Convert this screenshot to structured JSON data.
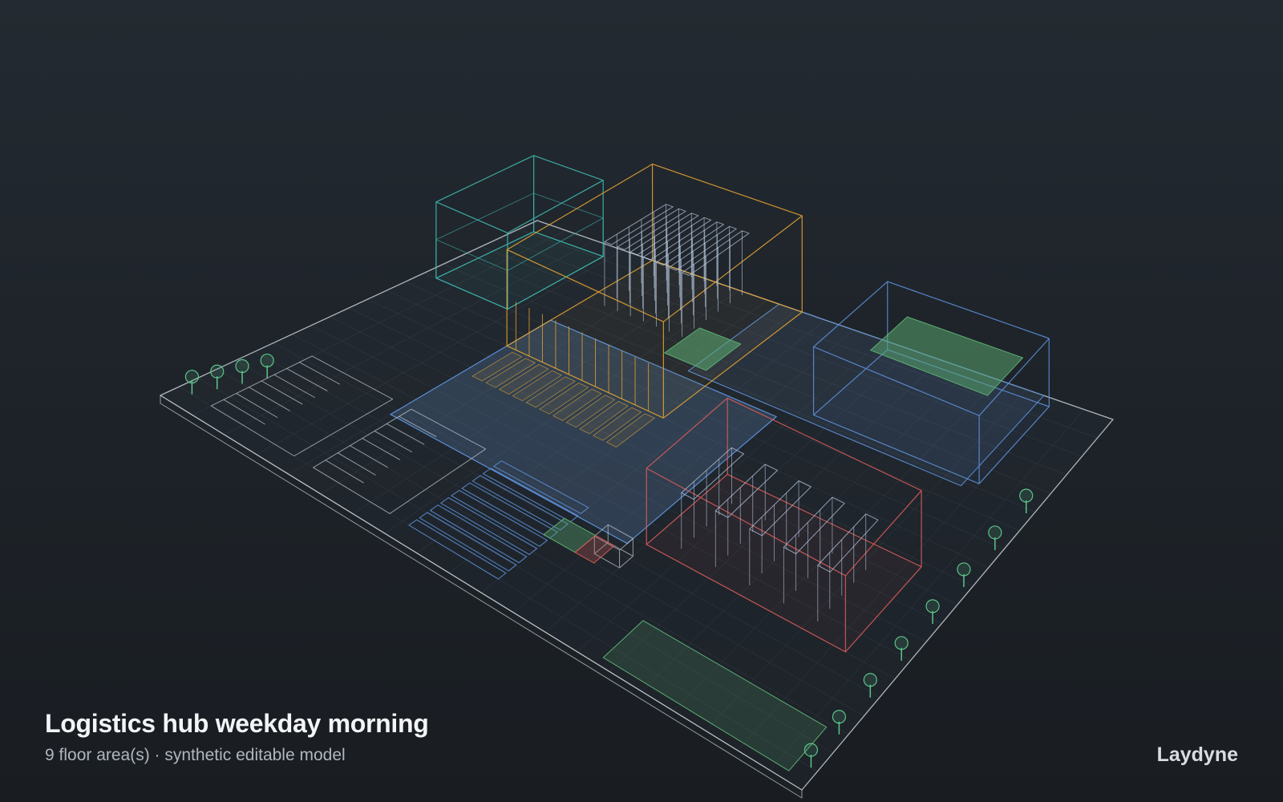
{
  "scene": {
    "title": "Logistics hub weekday morning",
    "subtitle": "9 floor area(s) · synthetic editable model",
    "floor_area_count": 9
  },
  "brand": {
    "name": "Laydyne"
  },
  "colors": {
    "background": "#1f252b",
    "site_outline": "#c9d0d6",
    "cyan_zone": "#3fb8b0",
    "orange_zone": "#e0a132",
    "blue_zone": "#5b8fd6",
    "red_zone": "#d75c58",
    "green_zone": "#5cae72",
    "rack": "#b8c8e0",
    "tree": "#5cc48a"
  },
  "floor_areas": [
    {
      "id": "office",
      "color_key": "cyan_zone"
    },
    {
      "id": "warehouse-north",
      "color_key": "orange_zone"
    },
    {
      "id": "cross-dock",
      "color_key": "blue_zone"
    },
    {
      "id": "cold-storage",
      "color_key": "red_zone"
    },
    {
      "id": "yard",
      "color_key": "blue_zone"
    },
    {
      "id": "parking",
      "color_key": "site_outline"
    },
    {
      "id": "truck-parking",
      "color_key": "blue_zone"
    },
    {
      "id": "green-strip",
      "color_key": "green_zone"
    },
    {
      "id": "gatehouse",
      "color_key": "site_outline"
    }
  ]
}
